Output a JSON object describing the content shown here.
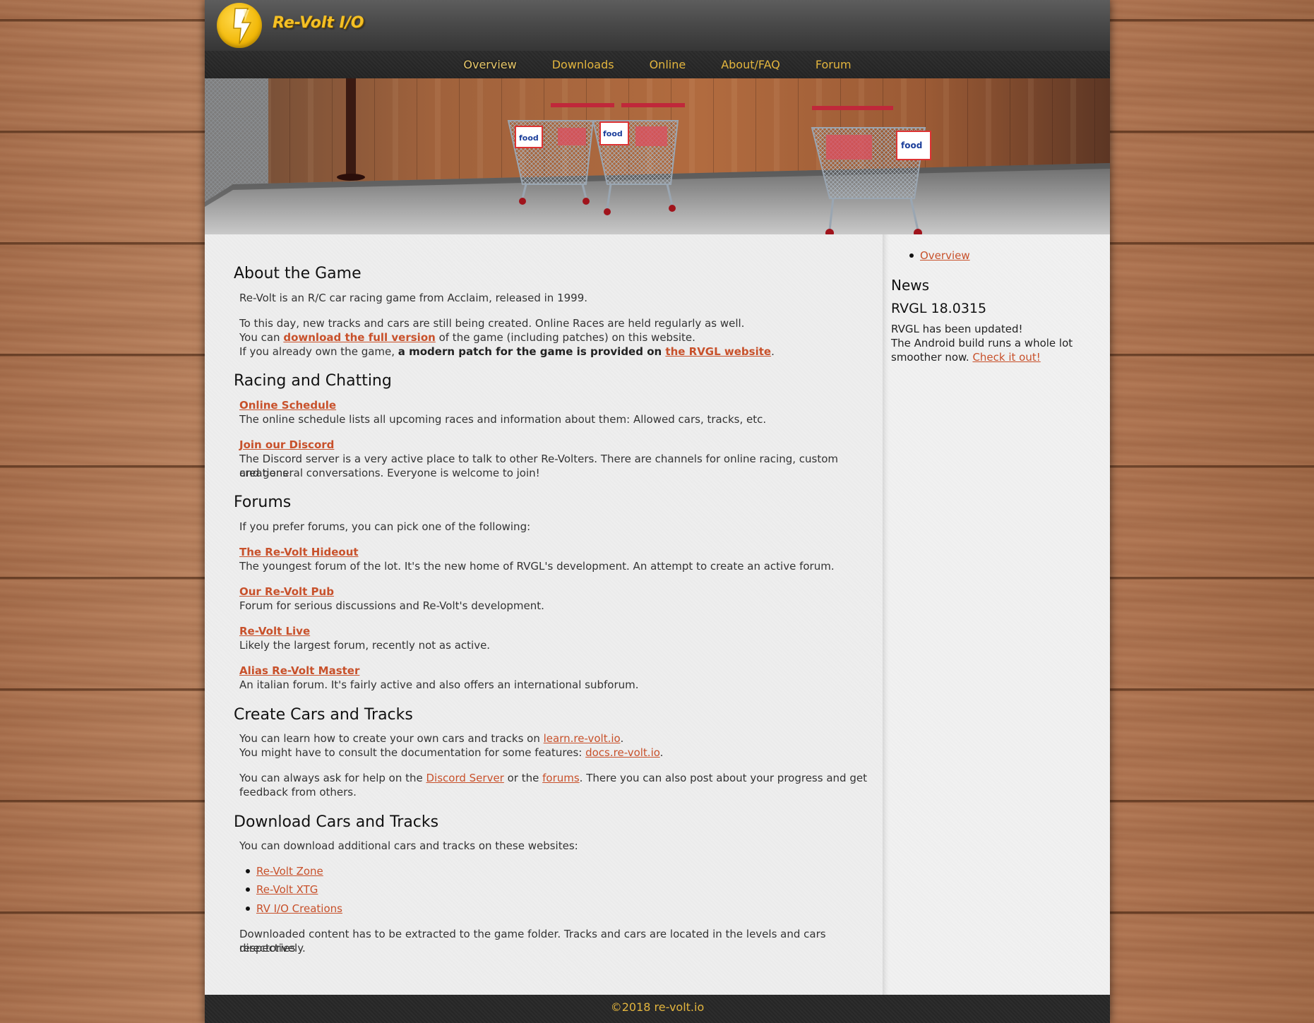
{
  "header": {
    "logo_text": "Re-Volt I/O"
  },
  "nav": {
    "items": [
      "Overview",
      "Downloads",
      "Online",
      "About/FAQ",
      "Forum"
    ],
    "active": "Overview"
  },
  "sections": {
    "about": {
      "title": "About the Game",
      "p1": "Re-Volt is an R/C car racing game from Acclaim, released in 1999.",
      "p2": "To this day, new tracks and cars are still being created. Online Races are held regularly as well.",
      "p3_pre": "You can ",
      "p3_link": "download the full version",
      "p3_post": " of the game (including patches) on this website.",
      "p4_pre": "If you already own the game, ",
      "p4_bold": "a modern patch for the game is provided on ",
      "p4_link": "the RVGL website",
      "p4_post": "."
    },
    "racing": {
      "title": "Racing and Chatting",
      "schedule_link": "Online Schedule",
      "schedule_desc": "The online schedule lists all upcoming races and information about them: Allowed cars, tracks, etc.",
      "discord_link": "Join our Discord",
      "discord_desc_1": "The Discord server is a very active place to talk to other Re-Volters. There are channels for online racing, custom creations",
      "discord_desc_2": "and general conversations. Everyone is welcome to join!"
    },
    "forums": {
      "title": "Forums",
      "intro": "If you prefer forums, you can pick one of the following:",
      "items": [
        {
          "name": "The Re-Volt Hideout",
          "desc": "The youngest forum of the lot. It's the new home of RVGL's development. An attempt to create an active forum."
        },
        {
          "name": "Our Re-Volt Pub",
          "desc": "Forum for serious discussions and Re-Volt's development."
        },
        {
          "name": "Re-Volt Live",
          "desc": "Likely the largest forum, recently not as active."
        },
        {
          "name": "Alias Re-Volt Master",
          "desc": "An italian forum. It's fairly active and also offers an international subforum."
        }
      ]
    },
    "create": {
      "title": "Create Cars and Tracks",
      "l1_pre": "You can learn how to create your own cars and tracks on ",
      "l1_link": "learn.re-volt.io",
      "l1_post": ".",
      "l2_pre": "You might have to consult the documentation for some features: ",
      "l2_link": "docs.re-volt.io",
      "l2_post": ".",
      "l3_pre": "You can always ask for help on the ",
      "l3_link1": "Discord Server",
      "l3_mid": " or the ",
      "l3_link2": "forums",
      "l3_post": ". There you can also post about your progress and get",
      "l4": "feedback from others."
    },
    "download": {
      "title": "Download Cars and Tracks",
      "intro": "You can download additional cars and tracks on these websites:",
      "sites": [
        "Re-Volt Zone",
        "Re-Volt XTG",
        "RV I/O Creations"
      ],
      "outro_1": "Downloaded content has to be extracted to the game folder. Tracks and cars are located in the levels and cars directories",
      "outro_2": "respectively."
    }
  },
  "sidebar": {
    "toc_item": "Overview",
    "news_title": "News",
    "news_headline": "RVGL 18.0315",
    "news_l1": "RVGL has been updated!",
    "news_l2": "The Android build runs a whole lot",
    "news_l3_pre": "smoother now. ",
    "news_link": "Check it out!"
  },
  "footer": {
    "text": "©2018 re-volt.io"
  },
  "colors": {
    "accent": "#e3b53e",
    "link": "#c8512b",
    "header_bg": "#484848",
    "content_bg": "#eeeeee"
  }
}
